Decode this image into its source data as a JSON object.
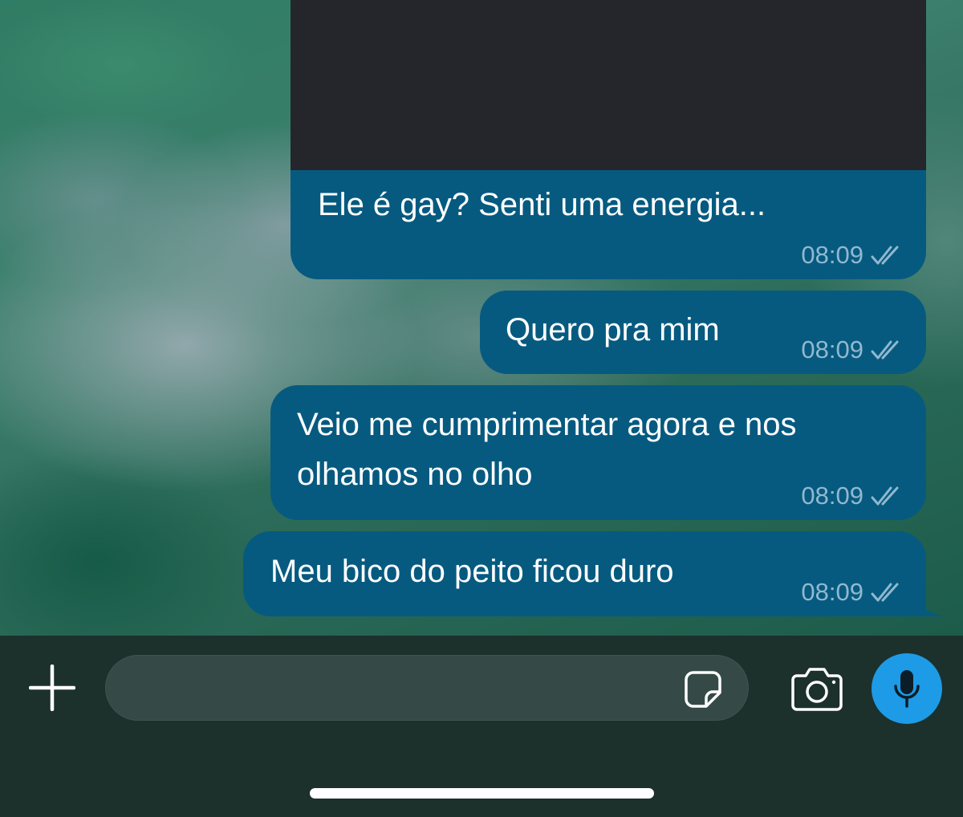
{
  "messages": [
    {
      "text": "Ele é gay? Senti uma energia...",
      "time": "08:09",
      "status": "read",
      "has_media": true
    },
    {
      "text": "Quero pra mim",
      "time": "08:09",
      "status": "read"
    },
    {
      "lines": [
        "Veio me cumprimentar agora e nos",
        "olhamos no olho"
      ],
      "time": "08:09",
      "status": "read"
    },
    {
      "text": "Meu bico do peito ficou duro",
      "time": "08:09",
      "status": "read"
    }
  ],
  "composer": {
    "input_value": "",
    "icons": [
      "plus-icon",
      "sticker-icon",
      "camera-icon",
      "microphone-icon"
    ]
  },
  "colors": {
    "bubble": "#065a80",
    "media_placeholder": "#24262b",
    "composer_bg": "#1c302c",
    "input_bg": "#354a46",
    "mic_button": "#1d9be6",
    "timestamp": "#b4c8d6"
  }
}
